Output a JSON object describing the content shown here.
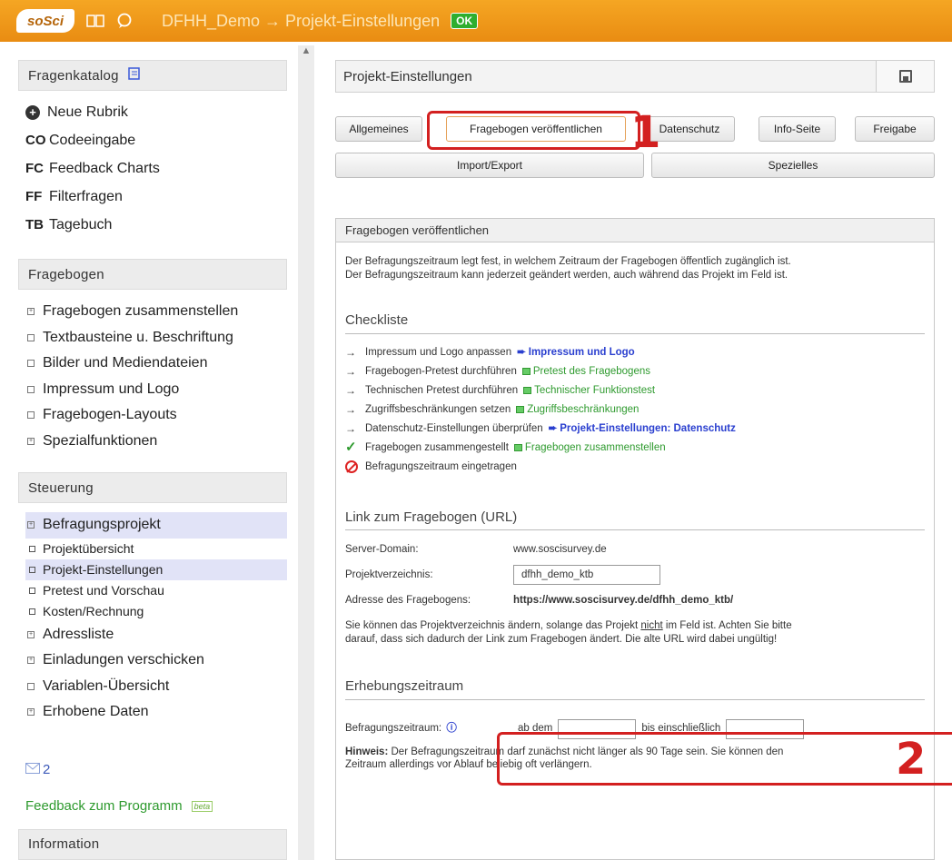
{
  "topbar": {
    "logo": "soSci",
    "title": "DFHH_Demo → Projekt-Einstellungen",
    "status": "OK"
  },
  "sidebar": {
    "fragenkatalog": {
      "title": "Fragenkatalog",
      "items": [
        {
          "code": "",
          "label": "Neue Rubrik"
        },
        {
          "code": "CO",
          "label": "Codeeingabe"
        },
        {
          "code": "FC",
          "label": "Feedback Charts"
        },
        {
          "code": "FF",
          "label": "Filterfragen"
        },
        {
          "code": "TB",
          "label": "Tagebuch"
        }
      ]
    },
    "fragebogen": {
      "title": "Fragebogen",
      "items": [
        "Fragebogen zusammenstellen",
        "Textbausteine u. Beschriftung",
        "Bilder und Mediendateien",
        "Impressum und Logo",
        "Fragebogen-Layouts",
        "Spezialfunktionen"
      ]
    },
    "steuerung": {
      "title": "Steuerung",
      "project": "Befragungsprojekt",
      "sub": [
        "Projektübersicht",
        "Projekt-Einstellungen",
        "Pretest und Vorschau",
        "Kosten/Rechnung"
      ],
      "items": [
        "Adressliste",
        "Einladungen verschicken",
        "Variablen-Übersicht",
        "Erhobene Daten"
      ]
    },
    "messages": "2",
    "feedback": "Feedback zum Programm",
    "beta": "beta",
    "information": "Information"
  },
  "main": {
    "page_title": "Projekt-Einstellungen",
    "tabs": {
      "allgemeines": "Allgemeines",
      "veroeffentlichen": "Fragebogen veröffentlichen",
      "datenschutz": "Datenschutz",
      "infoseite": "Info-Seite",
      "freigabe": "Freigabe",
      "import": "Import/Export",
      "spezielles": "Spezielles"
    },
    "annotations": {
      "one": "1",
      "two": "2"
    },
    "panel": {
      "title": "Fragebogen veröffentlichen",
      "intro1": "Der Befragungszeitraum legt fest, in welchem Zeitraum der Fragebogen öffentlich zugänglich ist.",
      "intro2": "Der Befragungszeitraum kann jederzeit geändert werden, auch während das Projekt im Feld ist.",
      "checklist_title": "Checkliste",
      "checklist": [
        {
          "text": "Impressum und Logo anpassen",
          "link": "Impressum und Logo",
          "kind": "blue"
        },
        {
          "text": "Fragebogen-Pretest durchführen",
          "link": "Pretest des Fragebogens",
          "kind": "green"
        },
        {
          "text": "Technischen Pretest durchführen",
          "link": "Technischer Funktionstest",
          "kind": "green"
        },
        {
          "text": "Zugriffsbeschränkungen setzen",
          "link": "Zugriffsbeschränkungen",
          "kind": "green"
        },
        {
          "text": "Datenschutz-Einstellungen überprüfen",
          "link": "Projekt-Einstellungen: Datenschutz",
          "kind": "blue"
        },
        {
          "text": "Fragebogen zusammengestellt",
          "link": "Fragebogen zusammenstellen",
          "kind": "green"
        },
        {
          "text": "Befragungszeitraum eingetragen",
          "link": "",
          "kind": "none"
        }
      ],
      "link_title": "Link zum Fragebogen (URL)",
      "server_label": "Server-Domain:",
      "server_value": "www.soscisurvey.de",
      "dir_label": "Projektverzeichnis:",
      "dir_value": "dfhh_demo_ktb",
      "address_label": "Adresse des Fragebogens:",
      "address_value": "https://www.soscisurvey.de/dfhh_demo_ktb/",
      "note_a": "Sie können das Projektverzeichnis ändern, solange das Projekt ",
      "note_nicht": "nicht",
      "note_b": " im Feld ist. Achten Sie bitte",
      "note_c": "darauf, dass sich dadurch der Link zum Fragebogen ändert. Die alte URL wird dabei ungültig!",
      "period_title": "Erhebungszeitraum",
      "period_label": "Befragungszeitraum:",
      "from_label": "ab dem",
      "to_label": "bis einschließlich",
      "hint_bold": "Hinweis:",
      "hint_a": " Der Befragungszeitraum darf zunächst nicht länger als 90 Tage sein. Sie können den",
      "hint_b": "Zeitraum allerdings vor Ablauf beliebig oft verlängern."
    }
  }
}
